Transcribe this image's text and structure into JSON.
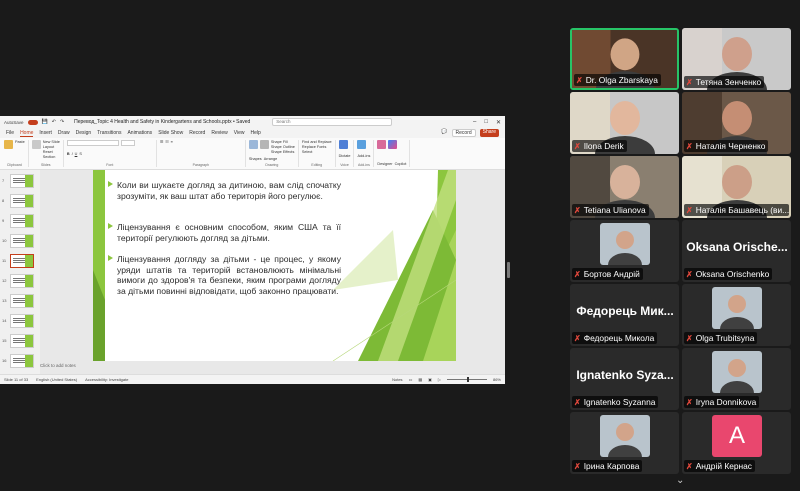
{
  "app": {
    "autosave": "AutoSave",
    "doc_title": "Перевод_Topic 4 Health and Safety in Kindergartens and Schools.pptx • Saved",
    "search": "Search",
    "tabs": [
      "File",
      "Home",
      "Insert",
      "Draw",
      "Design",
      "Transitions",
      "Animations",
      "Slide Show",
      "Record",
      "Review",
      "View",
      "Help"
    ],
    "active_tab": "Home",
    "record": "Record",
    "share": "Share",
    "ribbon_groups": [
      {
        "name": "Clipboard",
        "items": [
          "Paste"
        ]
      },
      {
        "name": "Slides",
        "items": [
          "New Slide",
          "Layout",
          "Reset",
          "Section"
        ]
      },
      {
        "name": "Font",
        "items": []
      },
      {
        "name": "Paragraph",
        "items": []
      },
      {
        "name": "Drawing",
        "items": [
          "Shapes",
          "Arrange",
          "Shape Fill",
          "Shape Outline",
          "Shape Effects"
        ]
      },
      {
        "name": "Editing",
        "items": [
          "Find and Replace",
          "Replace Fonts",
          "Select"
        ]
      },
      {
        "name": "Voice",
        "items": [
          "Dictate"
        ]
      },
      {
        "name": "Add-ins",
        "items": [
          "Add-ins"
        ]
      },
      {
        "name": "",
        "items": [
          "Designer",
          "Copilot"
        ]
      }
    ],
    "thumb_numbers": [
      "7",
      "8",
      "9",
      "10",
      "11",
      "12",
      "13",
      "14",
      "15",
      "16"
    ],
    "notes_placeholder": "Click to add notes",
    "status": {
      "slide": "Slide 11 of 33",
      "language": "English (United States)",
      "accessibility": "Accessibility: Investigate",
      "notes": "Notes",
      "zoom": "86%"
    }
  },
  "slide": {
    "bullets": [
      "Коли ви шукаєте догляд за дитиною, вам слід спочатку зрозуміти, як ваш штат або територія його регулює.",
      "Ліцензування є основним способом, яким США та її території регулюють догляд за дітьми.",
      "Ліцензування догляду за дітьми - це процес, у якому уряди штатів та територій встановлюють мінімальні вимоги до здоров'я та безпеки, яким програми догляду за дітьми повинні відповідати, щоб законно працювати."
    ],
    "accent_color": "#8cc63e"
  },
  "participants": [
    {
      "name": "Dr. Olga Zbarskaya",
      "type": "video",
      "active": true
    },
    {
      "name": "Тетяна Зенченко",
      "type": "video"
    },
    {
      "name": "Ilona Derik",
      "type": "video"
    },
    {
      "name": "Наталія Черненко",
      "type": "video"
    },
    {
      "name": "Tetiana Ulianova",
      "type": "video"
    },
    {
      "name": "Наталія Башавець (ви...",
      "type": "video"
    },
    {
      "name": "Бортов Андрій",
      "type": "photo"
    },
    {
      "name": "Oksana Orischenko",
      "type": "name",
      "big": "Oksana  Orische..."
    },
    {
      "name": "Федорець Микола",
      "type": "name",
      "big": "Федорець  Мик..."
    },
    {
      "name": "Olga Trubitsyna",
      "type": "photo"
    },
    {
      "name": "Ignatenko Syzanna",
      "type": "name",
      "big": "Ignatenko  Syza..."
    },
    {
      "name": "Iryna Donnikova",
      "type": "photo"
    },
    {
      "name": "Ірина Карпова",
      "type": "photo"
    },
    {
      "name": "Андрій Кернас",
      "type": "initial",
      "initial": "A"
    }
  ],
  "colors": {
    "active_border": "#27c467",
    "muted_mic": "#e0483c",
    "avatar_pink": "#e9476e",
    "ppt_accent": "#c43e1c"
  }
}
